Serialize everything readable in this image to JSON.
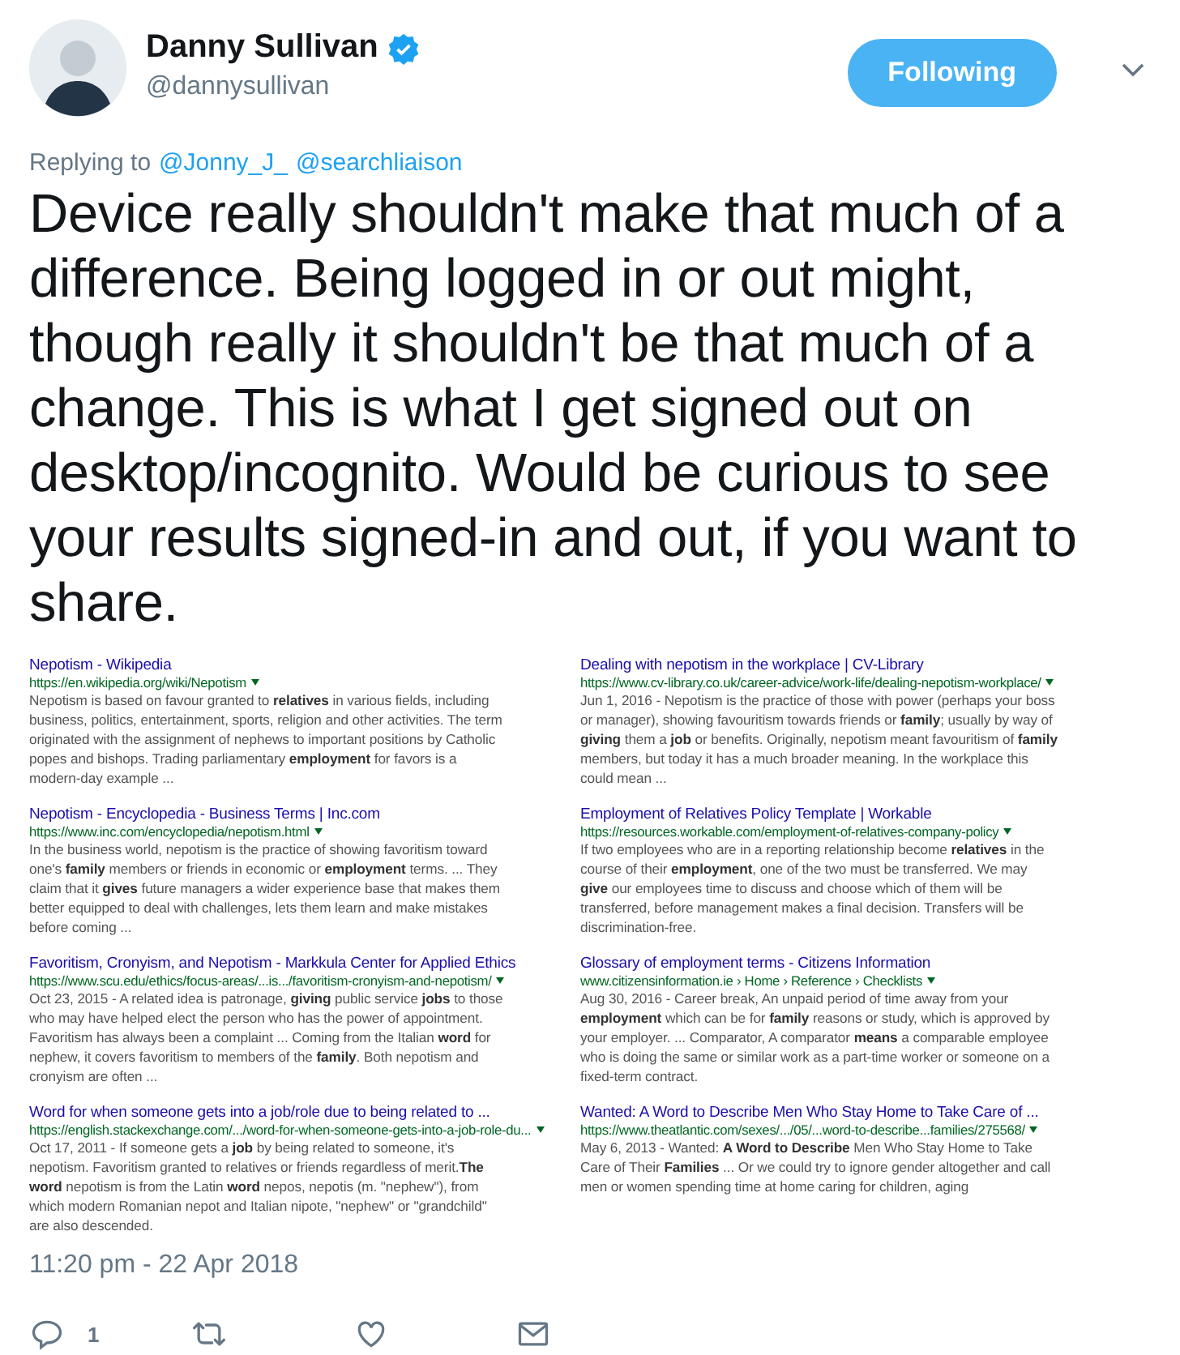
{
  "author": {
    "name": "Danny Sullivan",
    "handle": "@dannysullivan",
    "verified": true
  },
  "follow_button": {
    "label": "Following",
    "selected": true
  },
  "reply_context": {
    "prefix": "Replying to",
    "mentions": [
      "@Jonny_J_",
      "@searchliaison"
    ]
  },
  "text": "Device really shouldn't make that much of a difference. Being logged in or out might, though really it shouldn't be that much of a change. This is what I get signed out on desktop/incognito. Would be curious to see your results signed-in and out, if you want to share.",
  "attached_image": {
    "columns": [
      [
        {
          "title": "Nepotism - Wikipedia",
          "url": "https://en.wikipedia.org/wiki/Nepotism",
          "snippet": "Nepotism is based on favour granted to **relatives** in various fields, including business, politics, entertainment, sports, religion and other activities. The term originated with the assignment of nephews to important positions by Catholic popes and bishops. Trading parliamentary **employment** for favors is a modern-day example ..."
        },
        {
          "title": "Nepotism - Encyclopedia - Business Terms | Inc.com",
          "url": "https://www.inc.com/encyclopedia/nepotism.html",
          "snippet": "In the business world, nepotism is the practice of showing favoritism toward one's **family** members or friends in economic or **employment** terms. ... They claim that it **gives** future managers a wider experience base that makes them better equipped to deal with challenges, lets them learn and make mistakes before coming ..."
        },
        {
          "title": "Favoritism, Cronyism, and Nepotism - Markkula Center for Applied Ethics",
          "url": "https://www.scu.edu/ethics/focus-areas/...is.../favoritism-cronyism-and-nepotism/",
          "snippet": "Oct 23, 2015 - A related idea is patronage, **giving** public service **jobs** to those who may have helped elect the person who has the power of appointment. Favoritism has always been a complaint ... Coming from the Italian **word** for nephew, it covers favoritism to members of the **family**. Both nepotism and cronyism are often ..."
        },
        {
          "title": "Word for when someone gets into a job/role due to being related to ...",
          "url": "https://english.stackexchange.com/.../word-for-when-someone-gets-into-a-job-role-du...",
          "snippet": "Oct 17, 2011 - If someone gets a **job** by being related to someone, it's nepotism. Favoritism granted to relatives or friends regardless of merit.**The word** nepotism is from the Latin **word** nepos, nepotis (m. \"nephew\"), from which modern Romanian nepot and Italian nipote, \"nephew\" or \"grandchild\" are also descended."
        }
      ],
      [
        {
          "title": "Dealing with nepotism in the workplace | CV-Library",
          "url": "https://www.cv-library.co.uk/career-advice/work-life/dealing-nepotism-workplace/",
          "snippet": "Jun 1, 2016 - Nepotism is the practice of those with power (perhaps your boss or manager), showing favouritism towards friends or **family**; usually by way of **giving** them a **job** or benefits. Originally, nepotism meant favouritism of **family** members, but today it has a much broader meaning. In the workplace this could mean ..."
        },
        {
          "title": "Employment of Relatives Policy Template | Workable",
          "url": "https://resources.workable.com/employment-of-relatives-company-policy",
          "snippet": "If two employees who are in a reporting relationship become **relatives** in the course of their **employment**, one of the two must be transferred. We may **give** our employees time to discuss and choose which of them will be transferred, before management makes a final decision. Transfers will be discrimination-free."
        },
        {
          "title": "Glossary of employment terms - Citizens Information",
          "url": "www.citizensinformation.ie › Home › Reference › Checklists",
          "snippet": "Aug 30, 2016 - Career break, An unpaid period of time away from your **employment** which can be for **family** reasons or study, which is approved by your employer. ... Comparator, A comparator **means** a comparable employee who is doing the same or similar work as a part-time worker or someone on a fixed-term contract."
        },
        {
          "title": "Wanted: A Word to Describe Men Who Stay Home to Take Care of ...",
          "url": "https://www.theatlantic.com/sexes/.../05/...word-to-describe...families/275568/",
          "snippet": "May 6, 2013 - Wanted: **A Word to Describe** Men Who Stay Home to Take Care of Their **Families** ... Or we could try to ignore gender altogether and call men or women spending time at home caring for children, aging"
        }
      ]
    ]
  },
  "timestamp": "11:20 pm - 22 Apr 2018",
  "actions": [
    {
      "kind": "reply",
      "count": "1"
    },
    {
      "kind": "retweet"
    },
    {
      "kind": "like"
    },
    {
      "kind": "message"
    }
  ]
}
